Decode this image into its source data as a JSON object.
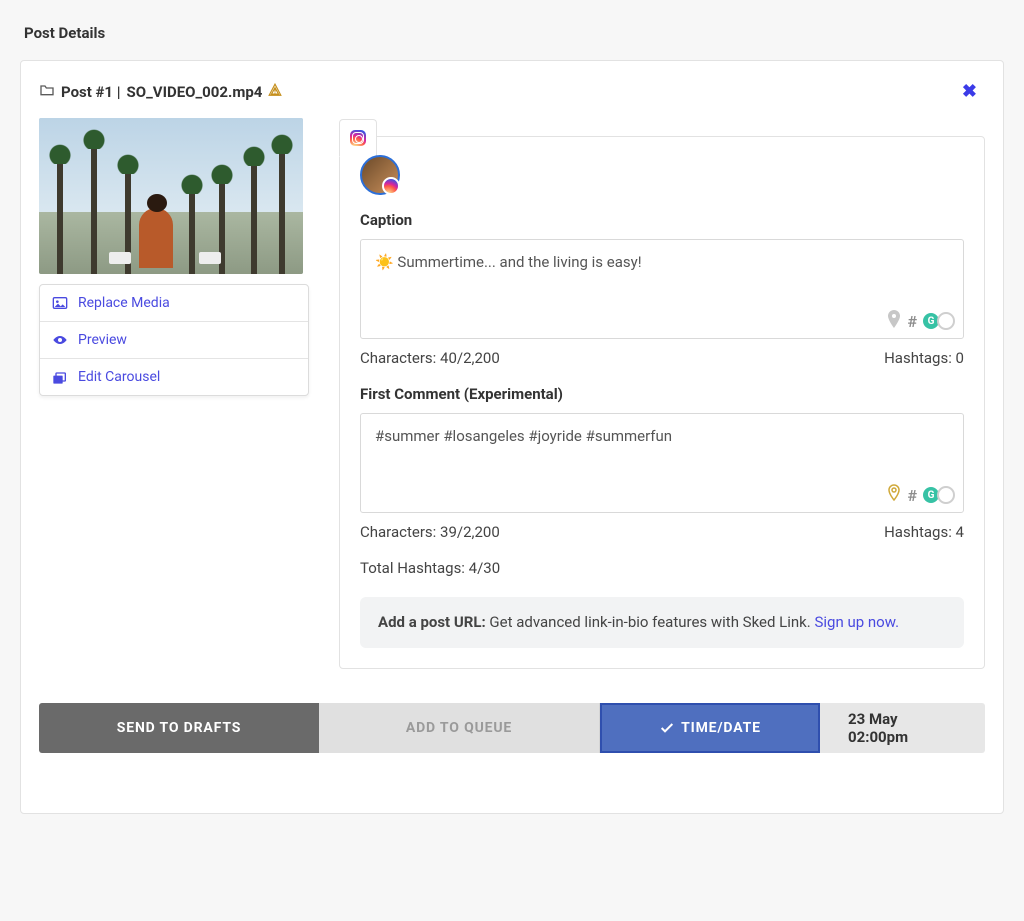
{
  "page_title": "Post Details",
  "post": {
    "header_prefix": "Post #1 | ",
    "filename": "SO_VIDEO_002.mp4",
    "warning": true
  },
  "media_actions": {
    "replace": "Replace Media",
    "preview": "Preview",
    "edit_carousel": "Edit Carousel"
  },
  "platform": {
    "name": "instagram-icon"
  },
  "caption": {
    "label": "Caption",
    "emoji": "☀️",
    "text": "Summertime... and the living is easy!",
    "char_count_label": "Characters: 40/2,200",
    "hashtags_label": "Hashtags: 0"
  },
  "first_comment": {
    "label": "First Comment (Experimental)",
    "text": "#summer #losangeles #joyride #summerfun",
    "char_count_label": "Characters: 39/2,200",
    "hashtags_label": "Hashtags: 4"
  },
  "total_hashtags_label": "Total Hashtags: 4/30",
  "url_promo": {
    "lead": "Add a post URL:",
    "body": " Get advanced link-in-bio features with Sked Link. ",
    "link": "Sign up now."
  },
  "footer": {
    "drafts": "Send to Drafts",
    "queue": "Add to Queue",
    "timedate": "Time/Date",
    "scheduled": "23 May 02:00pm"
  }
}
